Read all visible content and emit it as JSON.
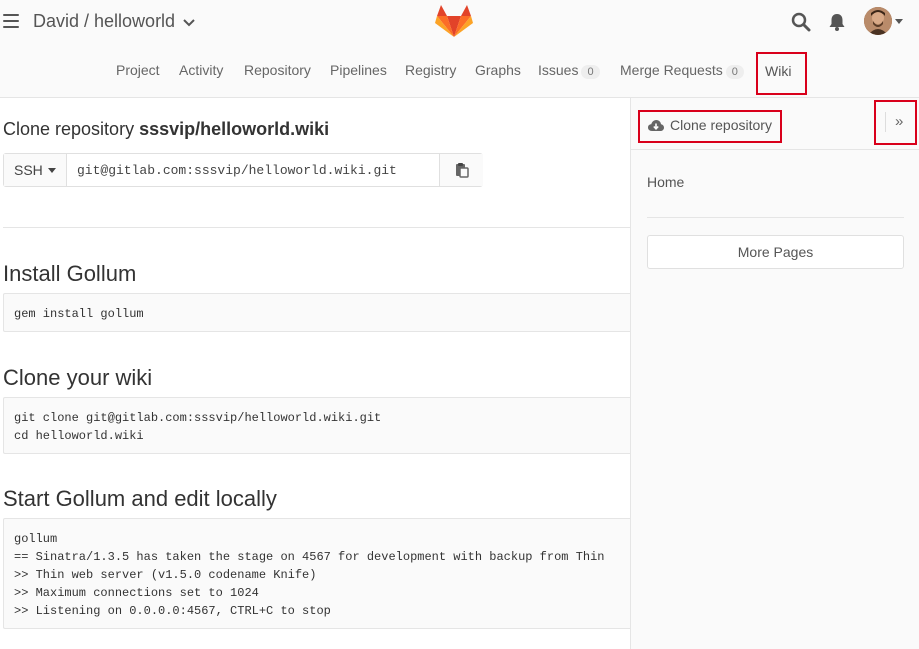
{
  "header": {
    "title": "David / helloworld",
    "icons": [
      "hamburger-icon",
      "chevron-down-icon",
      "gitlab-logo",
      "search-icon",
      "bell-icon",
      "avatar"
    ]
  },
  "nav": {
    "items": [
      {
        "label": "Project"
      },
      {
        "label": "Activity"
      },
      {
        "label": "Repository"
      },
      {
        "label": "Pipelines"
      },
      {
        "label": "Registry"
      },
      {
        "label": "Graphs"
      },
      {
        "label": "Issues",
        "count": "0"
      },
      {
        "label": "Merge Requests",
        "count": "0"
      },
      {
        "label": "Wiki"
      }
    ]
  },
  "main": {
    "clone_title_prefix": "Clone repository",
    "clone_title_repo": "sssvip/helloworld.wiki",
    "protocol": "SSH",
    "clone_url": "git@gitlab.com:sssvip/helloworld.wiki.git",
    "sections": [
      {
        "heading": "Install Gollum",
        "code": "gem install gollum"
      },
      {
        "heading": "Clone your wiki",
        "code": "git clone git@gitlab.com:sssvip/helloworld.wiki.git\ncd helloworld.wiki"
      },
      {
        "heading": "Start Gollum and edit locally",
        "code": "gollum\n== Sinatra/1.3.5 has taken the stage on 4567 for development with backup from Thin\n>> Thin web server (v1.5.0 codename Knife)\n>> Maximum connections set to 1024\n>> Listening on 0.0.0.0:4567, CTRL+C to stop"
      }
    ]
  },
  "sidebar": {
    "clone_label": "Clone repository",
    "toggle_label": "»",
    "pages": [
      "Home"
    ],
    "more_pages_label": "More Pages"
  },
  "colors": {
    "highlight": "#d9001b",
    "background": "#fafafa"
  }
}
